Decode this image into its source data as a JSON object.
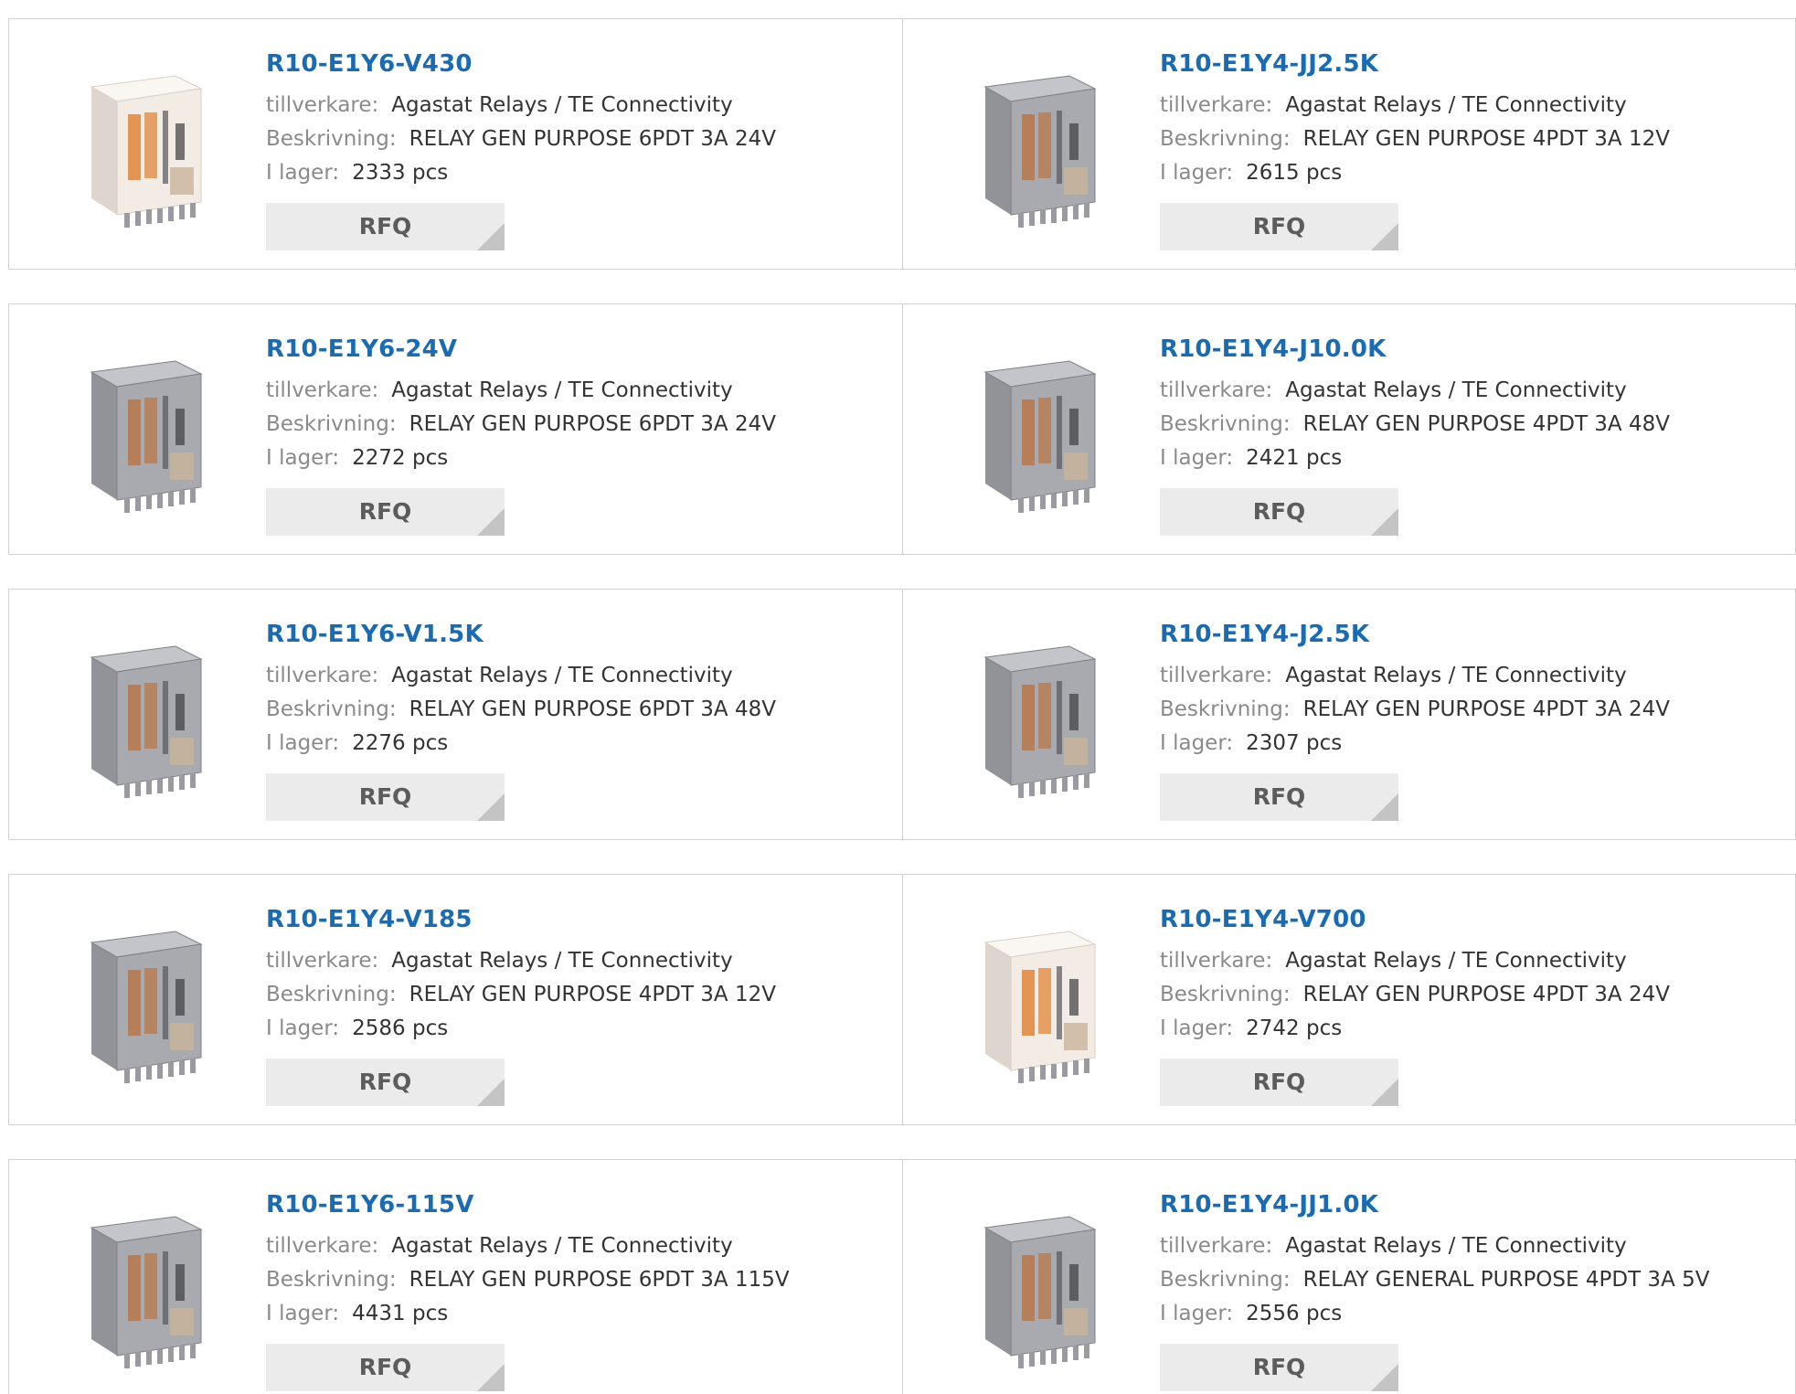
{
  "colors": {
    "part_number": "#1b6bb3",
    "label": "#8a8a8a",
    "value": "#333333",
    "rfq_bg": "#ebebeb",
    "border": "#d0d0d0"
  },
  "labels": {
    "manufacturer": "tillverkare:",
    "description": "Beskrivning:",
    "stock": "I lager:",
    "rfq": "RFQ"
  },
  "products": [
    {
      "part_number": "R10-E1Y6-V430",
      "manufacturer": "Agastat Relays / TE Connectivity",
      "description": "RELAY GEN PURPOSE 6PDT 3A 24V",
      "stock": "2333 pcs",
      "image": "relay-clear-icon"
    },
    {
      "part_number": "R10-E1Y4-JJ2.5K",
      "manufacturer": "Agastat Relays / TE Connectivity",
      "description": "RELAY GEN PURPOSE 4PDT 3A 12V",
      "stock": "2615 pcs",
      "image": "relay-grey-icon"
    },
    {
      "part_number": "R10-E1Y6-24V",
      "manufacturer": "Agastat Relays / TE Connectivity",
      "description": "RELAY GEN PURPOSE 6PDT 3A 24V",
      "stock": "2272 pcs",
      "image": "relay-grey-icon"
    },
    {
      "part_number": "R10-E1Y4-J10.0K",
      "manufacturer": "Agastat Relays / TE Connectivity",
      "description": "RELAY GEN PURPOSE 4PDT 3A 48V",
      "stock": "2421 pcs",
      "image": "relay-grey-icon"
    },
    {
      "part_number": "R10-E1Y6-V1.5K",
      "manufacturer": "Agastat Relays / TE Connectivity",
      "description": "RELAY GEN PURPOSE 6PDT 3A 48V",
      "stock": "2276 pcs",
      "image": "relay-grey-icon"
    },
    {
      "part_number": "R10-E1Y4-J2.5K",
      "manufacturer": "Agastat Relays / TE Connectivity",
      "description": "RELAY GEN PURPOSE 4PDT 3A 24V",
      "stock": "2307 pcs",
      "image": "relay-grey-icon"
    },
    {
      "part_number": "R10-E1Y4-V185",
      "manufacturer": "Agastat Relays / TE Connectivity",
      "description": "RELAY GEN PURPOSE 4PDT 3A 12V",
      "stock": "2586 pcs",
      "image": "relay-grey-icon"
    },
    {
      "part_number": "R10-E1Y4-V700",
      "manufacturer": "Agastat Relays / TE Connectivity",
      "description": "RELAY GEN PURPOSE 4PDT 3A 24V",
      "stock": "2742 pcs",
      "image": "relay-clear-icon"
    },
    {
      "part_number": "R10-E1Y6-115V",
      "manufacturer": "Agastat Relays / TE Connectivity",
      "description": "RELAY GEN PURPOSE 6PDT 3A 115V",
      "stock": "4431 pcs",
      "image": "relay-grey-icon"
    },
    {
      "part_number": "R10-E1Y4-JJ1.0K",
      "manufacturer": "Agastat Relays / TE Connectivity",
      "description": "RELAY GENERAL PURPOSE 4PDT 3A 5V",
      "stock": "2556 pcs",
      "image": "relay-grey-icon"
    }
  ]
}
